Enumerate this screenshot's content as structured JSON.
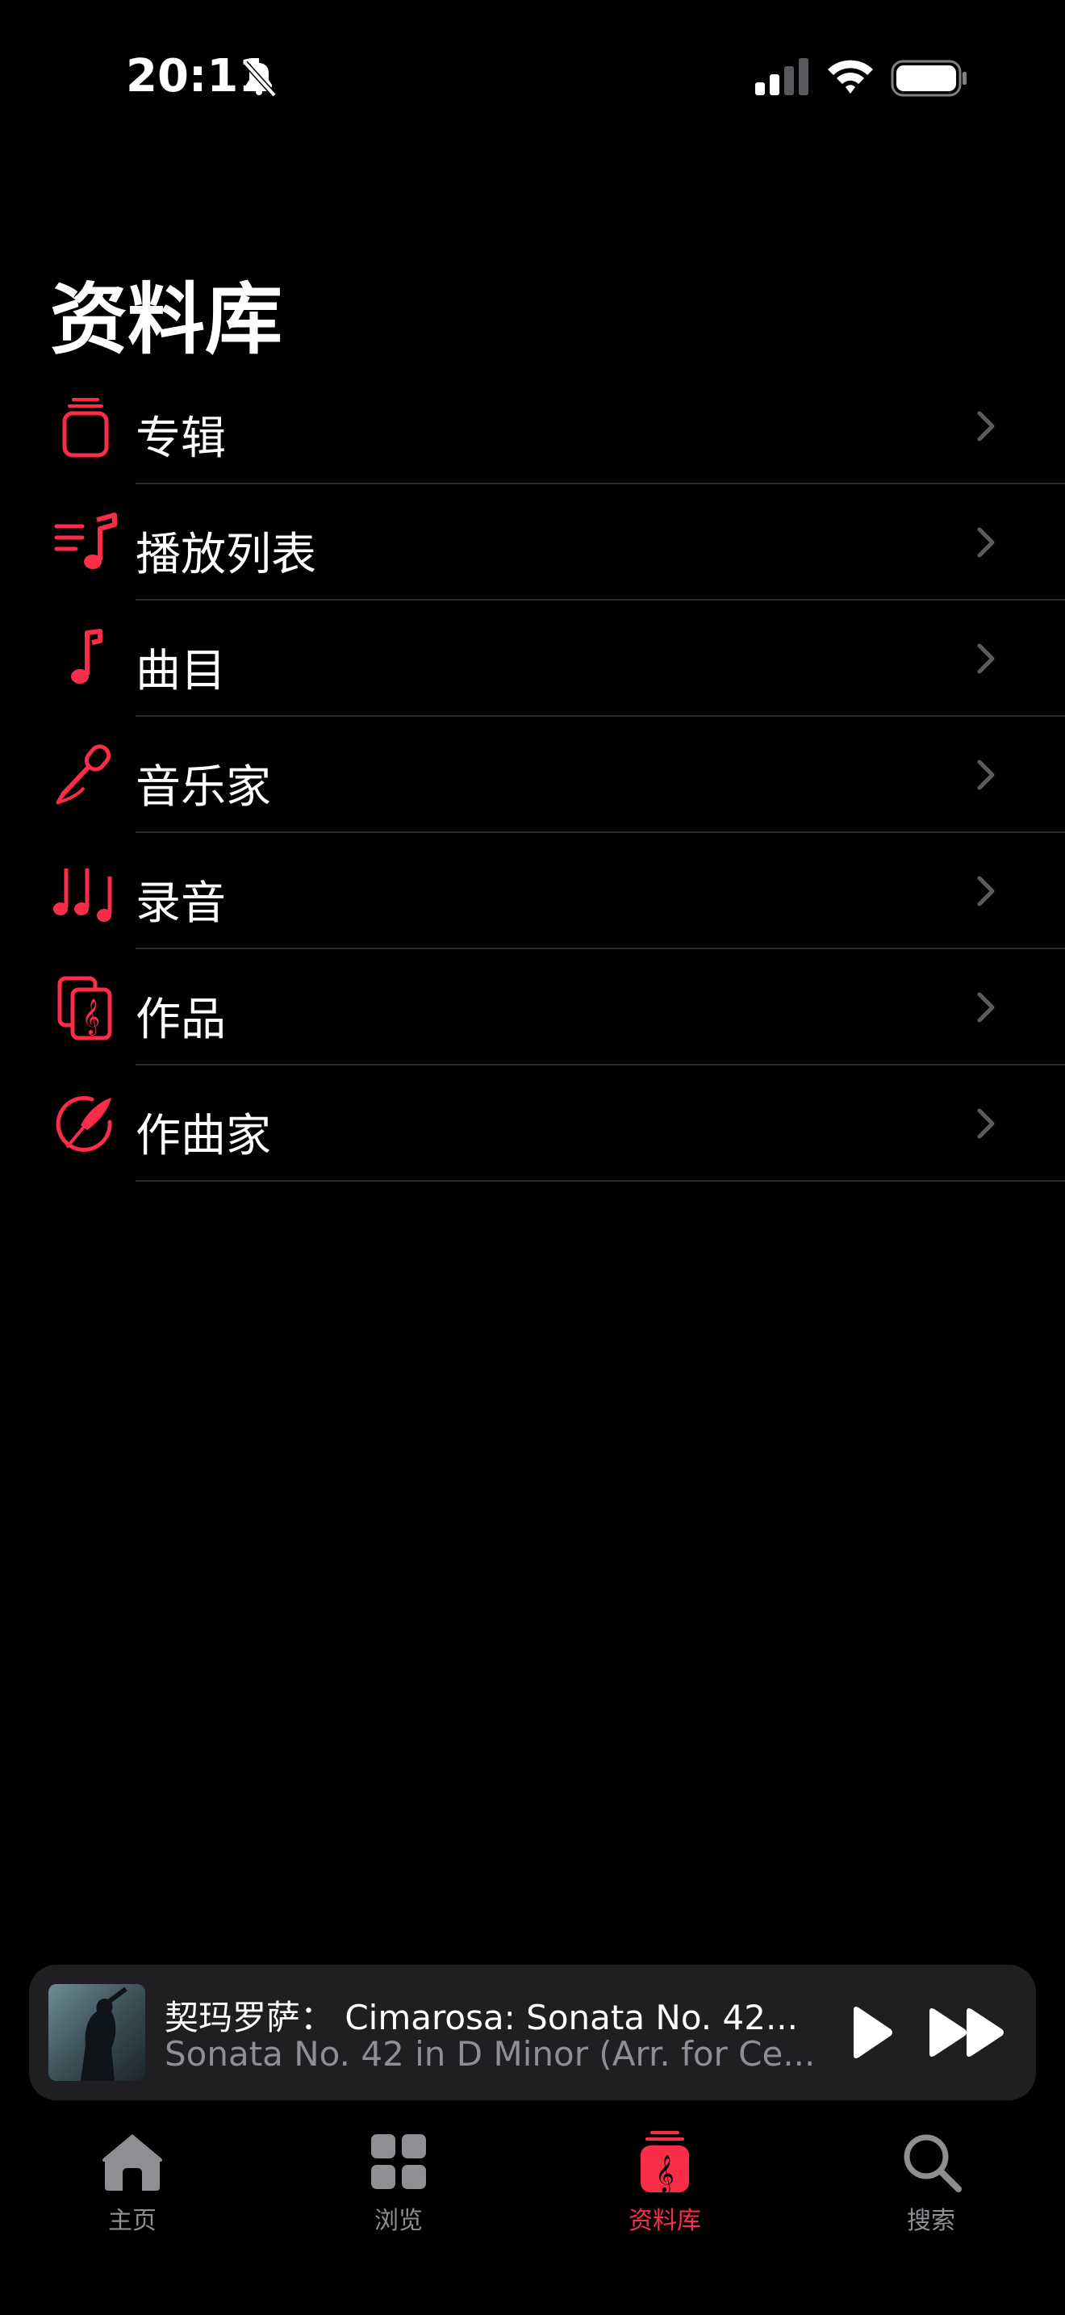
{
  "status_bar": {
    "time": "20:11"
  },
  "page": {
    "title": "资料库"
  },
  "library_items": [
    {
      "label": "专辑",
      "icon": "album-stack-icon"
    },
    {
      "label": "播放列表",
      "icon": "playlist-icon"
    },
    {
      "label": "曲目",
      "icon": "music-note-icon"
    },
    {
      "label": "音乐家",
      "icon": "microphone-icon"
    },
    {
      "label": "录音",
      "icon": "recordings-notes-icon"
    },
    {
      "label": "作品",
      "icon": "works-score-icon"
    },
    {
      "label": "作曲家",
      "icon": "composer-quill-icon"
    }
  ],
  "mini_player": {
    "title": "契玛罗萨： Cimarosa: Sonata No. 42...",
    "subtitle": "Sonata No. 42 in D Minor (Arr. for Ce..."
  },
  "tab_bar": {
    "tabs": [
      {
        "label": "主页",
        "icon": "home-icon"
      },
      {
        "label": "浏览",
        "icon": "grid-icon"
      },
      {
        "label": "资料库",
        "icon": "library-icon",
        "active": true
      },
      {
        "label": "搜索",
        "icon": "search-icon"
      }
    ]
  },
  "colors": {
    "accent": "#fa2d48",
    "background": "#000000",
    "secondary_text": "#8e8e93",
    "chevron": "#5b5b60"
  }
}
